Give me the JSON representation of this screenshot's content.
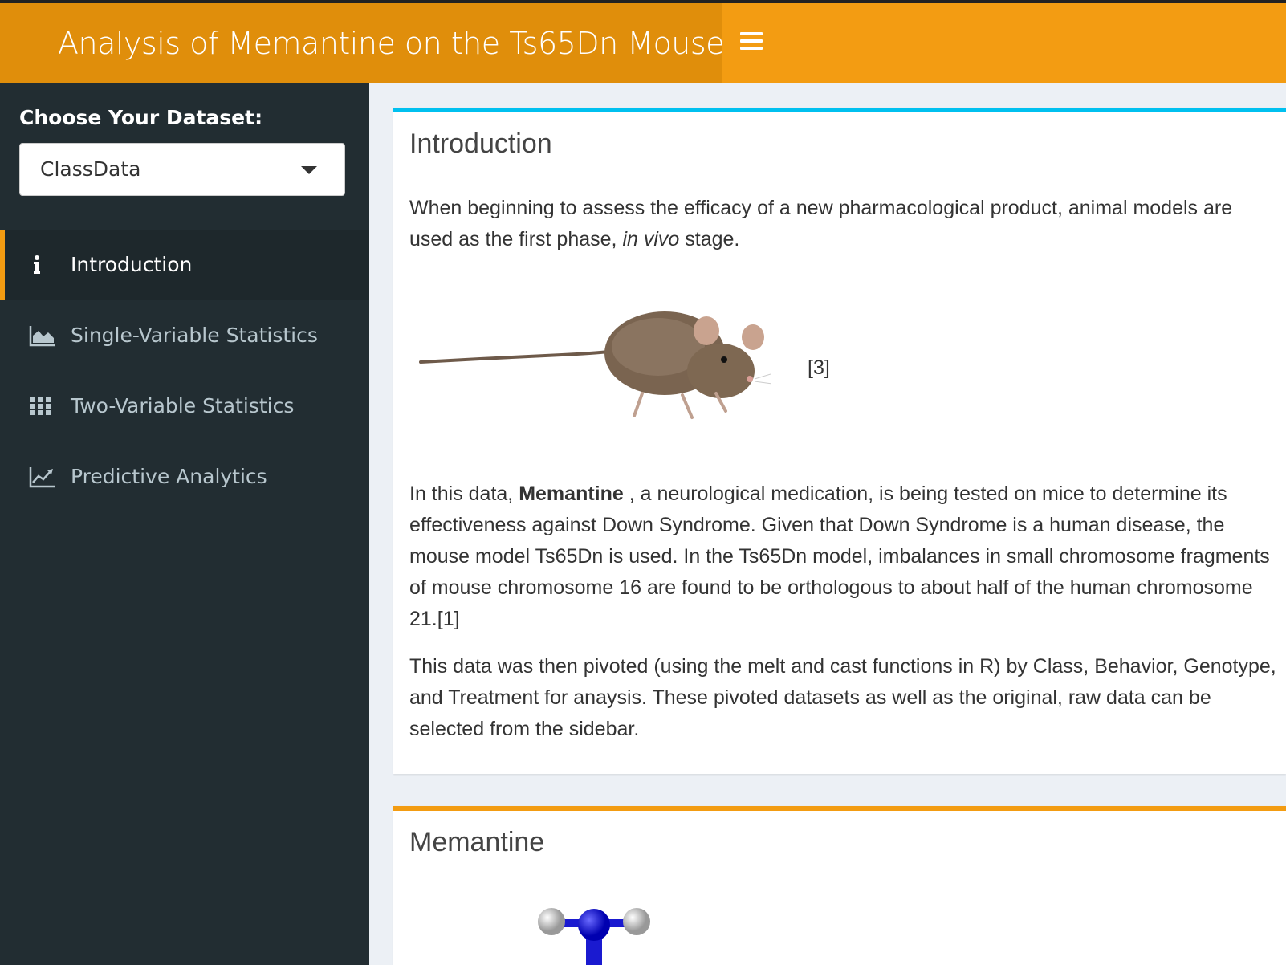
{
  "header": {
    "title": "Analysis of Memantine on the Ts65Dn Mouse",
    "colors": {
      "header": "#f39c12",
      "logo": "#e08e0b",
      "sidebar": "#222d32"
    }
  },
  "sidebar": {
    "dataset_label": "Choose Your Dataset:",
    "dataset_value": "ClassData",
    "items": [
      {
        "label": "Introduction",
        "icon": "info-icon",
        "active": true
      },
      {
        "label": "Single-Variable Statistics",
        "icon": "area-chart-icon",
        "active": false
      },
      {
        "label": "Two-Variable Statistics",
        "icon": "grid-icon",
        "active": false
      },
      {
        "label": "Predictive Analytics",
        "icon": "line-chart-icon",
        "active": false
      }
    ]
  },
  "main": {
    "intro": {
      "title": "Introduction",
      "p1_text": "When beginning to assess the efficacy of a new pharmacological product, animal models are used as the first phase, ",
      "p1_italic": "in vivo",
      "p1_end": " stage.",
      "image_citation": "[3]",
      "p2_start": "In this data, ",
      "p2_bold": "Memantine",
      "p2_rest": " , a neurological medication, is being tested on mice to determine its effectiveness against Down Syndrome. Given that Down Syndrome is a human disease, the mouse model Ts65Dn is used. In the Ts65Dn model, imbalances in small chromosome fragments of mouse chromosome 16 are found to be orthologous to about half of the human chromosome 21.[1]",
      "p3": "This data was then pivoted (using the melt and cast functions in R) by Class, Behavior, Genotype, and Treatment for anaysis. These pivoted datasets as well as the original, raw data can be selected from the sidebar."
    },
    "memantine": {
      "title": "Memantine"
    }
  }
}
